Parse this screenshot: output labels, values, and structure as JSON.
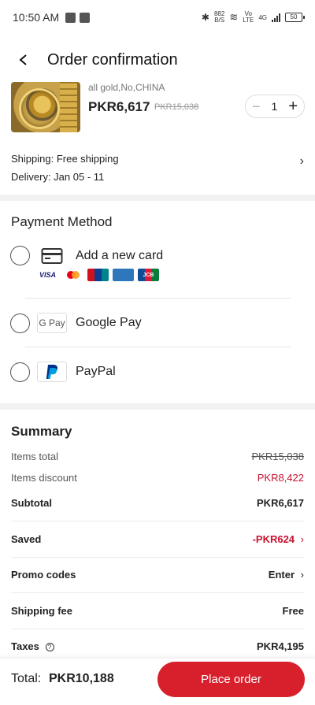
{
  "status_bar": {
    "time": "10:50 AM",
    "net_speed_value": "882",
    "net_speed_unit": "B/S",
    "volte_line1": "Vo",
    "volte_line2": "LTE",
    "signal": "4G",
    "battery": "50"
  },
  "header": {
    "title": "Order confirmation"
  },
  "product": {
    "variant": "all gold,No,CHINA",
    "price": "PKR6,617",
    "original_price": "PKR15,038",
    "quantity": "1",
    "minus": "−",
    "plus": "+"
  },
  "shipping": {
    "shipping_text": "Shipping: Free shipping",
    "delivery_text": "Delivery: Jan 05 - 11"
  },
  "payment": {
    "title": "Payment Method",
    "options": [
      {
        "label": "Add a new card",
        "icon": "credit-card-icon"
      },
      {
        "label": "Google Pay",
        "icon": "google-pay-icon",
        "badge": "G Pay"
      },
      {
        "label": "PayPal",
        "icon": "paypal-icon"
      }
    ],
    "card_logos": [
      "VISA",
      "Mastercard",
      "UnionPay",
      "AMERICAN EXPRESS",
      "JCB"
    ]
  },
  "summary": {
    "title": "Summary",
    "items_total_label": "Items total",
    "items_total_value": "PKR15,038",
    "items_discount_label": "Items discount",
    "items_discount_value": "PKR8,422",
    "subtotal_label": "Subtotal",
    "subtotal_value": "PKR6,617",
    "saved_label": "Saved",
    "saved_value": "-PKR624",
    "promo_label": "Promo codes",
    "promo_value": "Enter",
    "shipping_fee_label": "Shipping fee",
    "shipping_fee_value": "Free",
    "taxes_label": "Taxes",
    "taxes_value": "PKR4,195"
  },
  "footer": {
    "total_label": "Total:",
    "total_value": "PKR10,188",
    "place_order": "Place order"
  },
  "colors": {
    "accent": "#d81f2c",
    "discount_red": "#c8102e"
  }
}
